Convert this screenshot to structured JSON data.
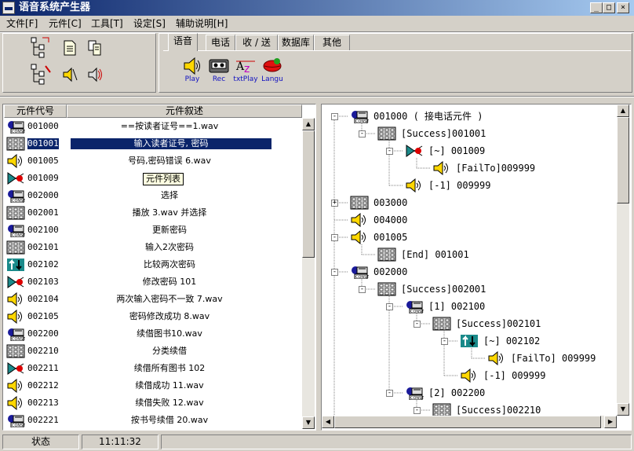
{
  "window": {
    "title": "语音系统产生器"
  },
  "menu": [
    "文件[F]",
    "元件[C]",
    "工具[T]",
    "设定[S]",
    "辅助说明[H]"
  ],
  "tabs": [
    "语音",
    "电话",
    "收 / 送",
    "数据库",
    "其他"
  ],
  "voice_buttons": [
    "Play",
    "Rec",
    "txtPlay",
    "Langu"
  ],
  "list": {
    "headers": {
      "code": "元件代号",
      "desc": "元件叙述"
    },
    "tooltip": "元件列表",
    "rows": [
      {
        "icon": "phone",
        "code": "001000",
        "desc": "==按读者证号==1.wav"
      },
      {
        "icon": "grid",
        "code": "001001",
        "desc": "输入读者证号, 密码"
      },
      {
        "icon": "speaker",
        "code": "001005",
        "desc": "号码,密码错误 6.wav"
      },
      {
        "icon": "fork",
        "code": "001009",
        "desc": ""
      },
      {
        "icon": "phone",
        "code": "002000",
        "desc": "选择"
      },
      {
        "icon": "grid",
        "code": "002001",
        "desc": "播放 3.wav 并选择"
      },
      {
        "icon": "phone",
        "code": "002100",
        "desc": "更新密码"
      },
      {
        "icon": "grid",
        "code": "002101",
        "desc": "输入2次密码"
      },
      {
        "icon": "compare",
        "code": "002102",
        "desc": "比较两次密码"
      },
      {
        "icon": "fork",
        "code": "002103",
        "desc": "修改密码 101"
      },
      {
        "icon": "speaker",
        "code": "002104",
        "desc": "两次输入密码不一致 7.wav"
      },
      {
        "icon": "speaker",
        "code": "002105",
        "desc": "密码修改成功 8.wav"
      },
      {
        "icon": "phone",
        "code": "002200",
        "desc": "续借图书10.wav"
      },
      {
        "icon": "grid",
        "code": "002210",
        "desc": "分类续借"
      },
      {
        "icon": "fork",
        "code": "002211",
        "desc": "续借所有图书 102"
      },
      {
        "icon": "speaker",
        "code": "002212",
        "desc": "续借成功 11.wav"
      },
      {
        "icon": "speaker",
        "code": "002213",
        "desc": "续借失败 12.wav"
      },
      {
        "icon": "phone",
        "code": "002221",
        "desc": "按书号续借 20.wav"
      }
    ]
  },
  "tree": [
    {
      "icon": "phone",
      "label": "001000 ( 接电话元件 )"
    },
    {
      "icon": "grid",
      "label": "[Success]001001"
    },
    {
      "icon": "fork",
      "label": "[~] 001009"
    },
    {
      "icon": "speaker",
      "label": "[FailTo]009999"
    },
    {
      "icon": "speaker",
      "label": "[-1] 009999"
    },
    {
      "icon": "grid",
      "label": "003000"
    },
    {
      "icon": "speaker",
      "label": "004000"
    },
    {
      "icon": "speaker",
      "label": "001005"
    },
    {
      "icon": "grid",
      "label": "[End] 001001"
    },
    {
      "icon": "phone",
      "label": "002000"
    },
    {
      "icon": "grid",
      "label": "[Success]002001"
    },
    {
      "icon": "phone",
      "label": "[1] 002100"
    },
    {
      "icon": "grid",
      "label": "[Success]002101"
    },
    {
      "icon": "compare",
      "label": "[~] 002102"
    },
    {
      "icon": "speaker",
      "label": "[FailTo] 009999"
    },
    {
      "icon": "speaker",
      "label": "[-1] 009999"
    },
    {
      "icon": "phone",
      "label": "[2] 002200"
    },
    {
      "icon": "grid",
      "label": "[Success]002210"
    }
  ],
  "status": {
    "label": "状态",
    "time": "11:11:32"
  }
}
